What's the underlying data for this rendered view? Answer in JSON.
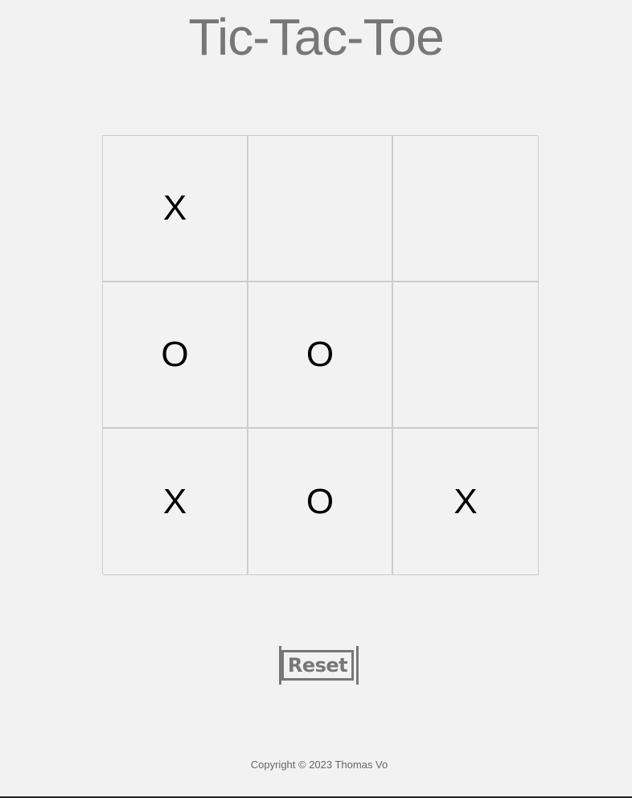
{
  "title": "Tic-Tac-Toe",
  "board": {
    "cells": [
      [
        "X",
        "",
        ""
      ],
      [
        "O",
        "O",
        ""
      ],
      [
        "X",
        "O",
        "X"
      ]
    ]
  },
  "reset_label": "Reset",
  "footer": "Copyright © 2023 Thomas Vo",
  "colors": {
    "background": "#f2f2f2",
    "title": "#777777",
    "grid_line": "#cccccc",
    "mark": "#000000"
  }
}
